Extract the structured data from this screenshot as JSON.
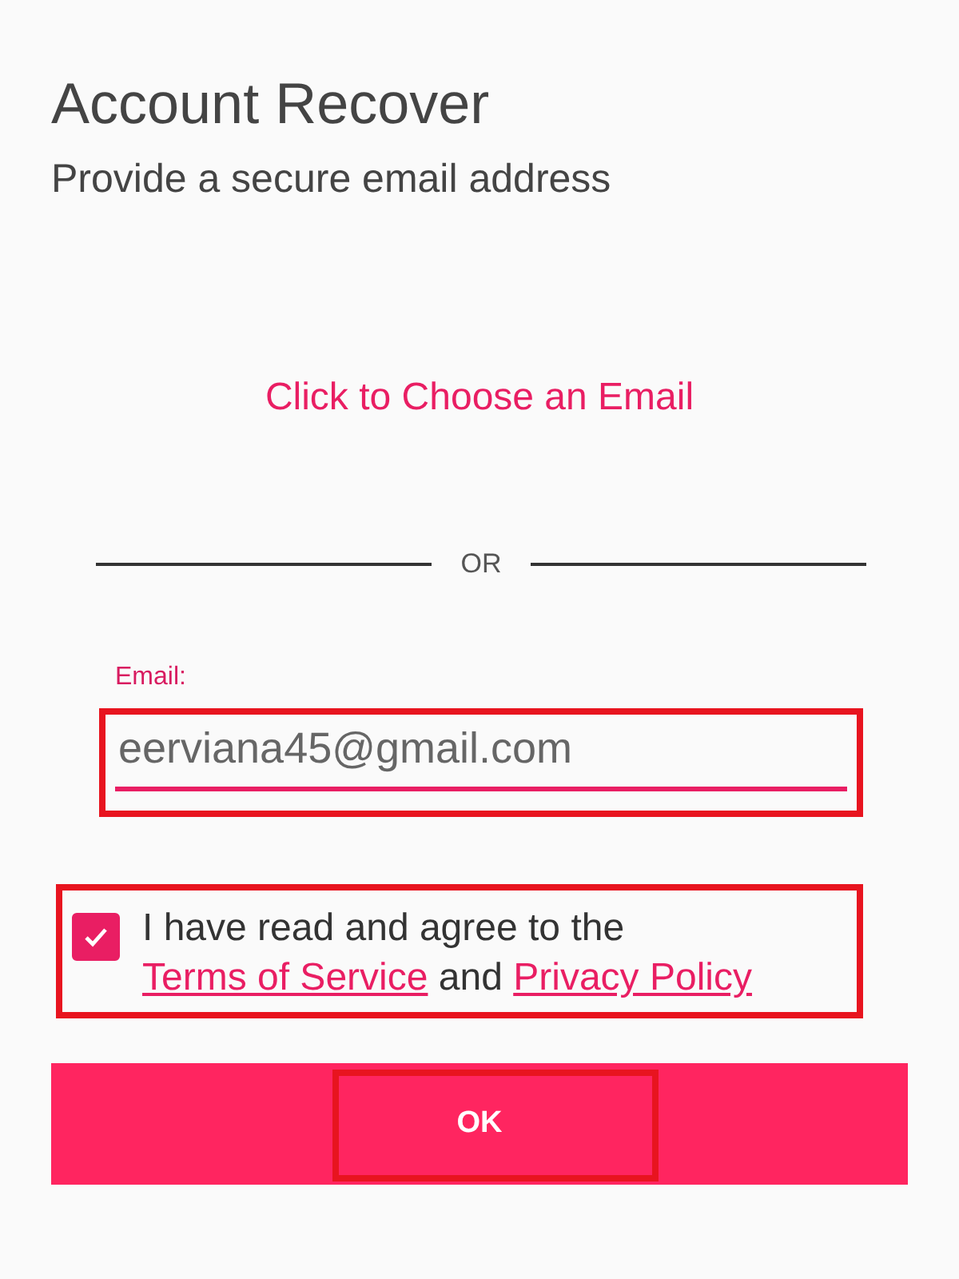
{
  "header": {
    "title": "Account Recover",
    "subtitle": "Provide a secure email address"
  },
  "choose_email_link": "Click to Choose an Email",
  "divider_label": "OR",
  "email_field": {
    "label": "Email:",
    "value": "eerviana45@gmail.com"
  },
  "consent": {
    "checked": true,
    "text_before": "I have read and agree to the ",
    "terms_link": "Terms of Service",
    "text_between": " and ",
    "privacy_link": "Privacy Policy"
  },
  "ok_button": "OK"
}
